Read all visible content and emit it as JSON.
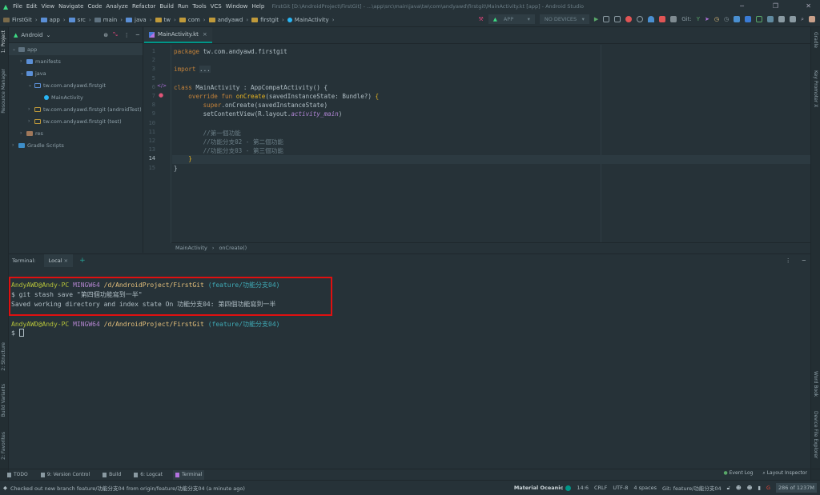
{
  "menu": {
    "items": [
      "File",
      "Edit",
      "View",
      "Navigate",
      "Code",
      "Analyze",
      "Refactor",
      "Build",
      "Run",
      "Tools",
      "VCS",
      "Window",
      "Help"
    ],
    "window_title": "FirstGit [D:\\AndroidProject\\FirstGit] - ...\\app\\src\\main\\java\\tw\\com\\andyawd\\firstgit\\MainActivity.kt [app] - Android Studio"
  },
  "breadcrumb": [
    "FirstGit",
    "app",
    "src",
    "main",
    "java",
    "tw",
    "com",
    "andyawd",
    "firstgit",
    "MainActivity"
  ],
  "toolbar": {
    "run_config": "APP",
    "device": "NO DEVICES",
    "git_label": "Git:"
  },
  "left_strip": [
    "1: Project",
    "Resource Manager",
    "2: Structure",
    "Build Variants",
    "2: Favorites"
  ],
  "right_strip": [
    "Gradle",
    "Key Promoter X",
    "Word Book",
    "Device File Explorer"
  ],
  "project": {
    "view": "Android",
    "tree": [
      {
        "label": "app",
        "depth": 0,
        "open": true
      },
      {
        "label": "manifests",
        "depth": 1,
        "open": false
      },
      {
        "label": "java",
        "depth": 1,
        "open": true
      },
      {
        "label": "tw.com.andyawd.firstgit",
        "depth": 2,
        "open": true
      },
      {
        "label": "MainActivity",
        "depth": 3,
        "leaf": true
      },
      {
        "label": "tw.com.andyawd.firstgit (androidTest)",
        "depth": 2,
        "open": false
      },
      {
        "label": "tw.com.andyawd.firstgit (test)",
        "depth": 2,
        "open": false
      },
      {
        "label": "res",
        "depth": 1,
        "open": false
      },
      {
        "label": "Gradle Scripts",
        "depth": 0,
        "open": false
      }
    ]
  },
  "editor": {
    "tab": "MainActivity.kt",
    "current_line": 14,
    "crumbs": [
      "MainActivity",
      "onCreate()"
    ]
  },
  "terminal": {
    "label": "Terminal:",
    "tab": "Local",
    "user": "AndyAWD@Andy-PC",
    "host": "MINGW64",
    "path": "/d/AndroidProject/FirstGit",
    "branch": "(feature/功能分支04)",
    "command": "$ git stash save \"第四個功能寫到一半\"",
    "output": "Saved working directory and index state On 功能分支04: 第四個功能寫到一半",
    "prompt": "$ "
  },
  "bottom_tools": [
    "TODO",
    "9: Version Control",
    "Build",
    "6: Logcat",
    "Terminal"
  ],
  "bottom_right": [
    "Event Log",
    "Layout Inspector"
  ],
  "status": {
    "message": "Checked out new branch feature/功能分支04 from origin/feature/功能分支04 (a minute ago)",
    "theme": "Material Oceanic",
    "position": "14:6",
    "line_sep": "CRLF",
    "encoding": "UTF-8",
    "indent": "4 spaces",
    "git": "Git: feature/功能分支04",
    "memory": "286 of 1237M"
  },
  "colors": {
    "background": "#263238",
    "accent": "#009688",
    "highlight_box": "#e01010"
  }
}
